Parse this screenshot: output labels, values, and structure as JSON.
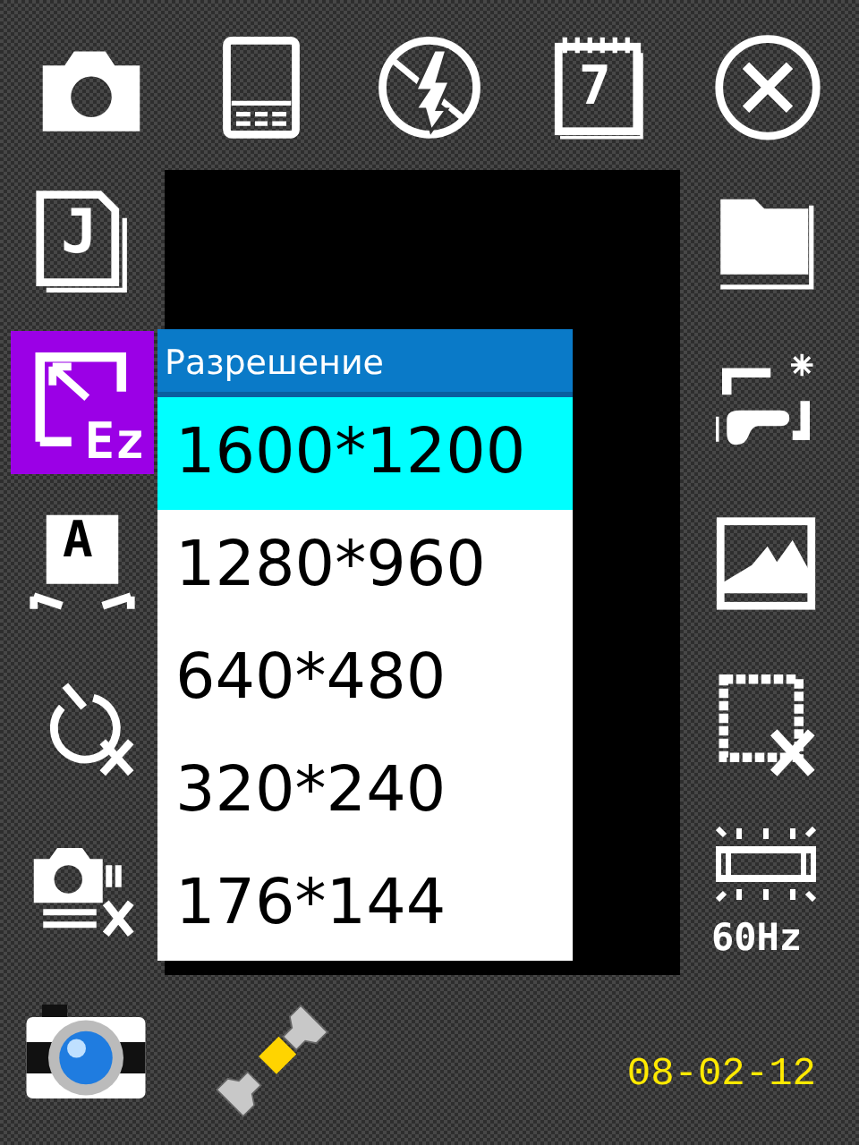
{
  "top_toolbar": [
    {
      "kind": "camera"
    },
    {
      "kind": "phone"
    },
    {
      "kind": "flash-off"
    },
    {
      "kind": "calendar",
      "glyph": "7"
    },
    {
      "kind": "close"
    }
  ],
  "left_menu": [
    {
      "kind": "document",
      "glyph": "J",
      "selected": false
    },
    {
      "kind": "resize",
      "glyph": "Ez",
      "selected": true
    },
    {
      "kind": "text-frame",
      "glyph": "A",
      "selected": false
    },
    {
      "kind": "timer-off",
      "selected": false
    },
    {
      "kind": "burst-off",
      "selected": false
    }
  ],
  "right_menu": [
    {
      "kind": "folder"
    },
    {
      "kind": "light-meter"
    },
    {
      "kind": "landscape"
    },
    {
      "kind": "frame-off"
    },
    {
      "kind": "flicker",
      "glyph": "60Hz"
    }
  ],
  "resolution_menu": {
    "title": "Разрешение",
    "options": [
      {
        "label": "1600*1200",
        "selected": true
      },
      {
        "label": "1280*960",
        "selected": false
      },
      {
        "label": "640*480",
        "selected": false
      },
      {
        "label": "320*240",
        "selected": false
      },
      {
        "label": "176*144",
        "selected": false
      }
    ]
  },
  "bottom_bar": {
    "items": [
      {
        "kind": "camera-app"
      },
      {
        "kind": "wrench"
      }
    ],
    "date": "08-02-12"
  }
}
